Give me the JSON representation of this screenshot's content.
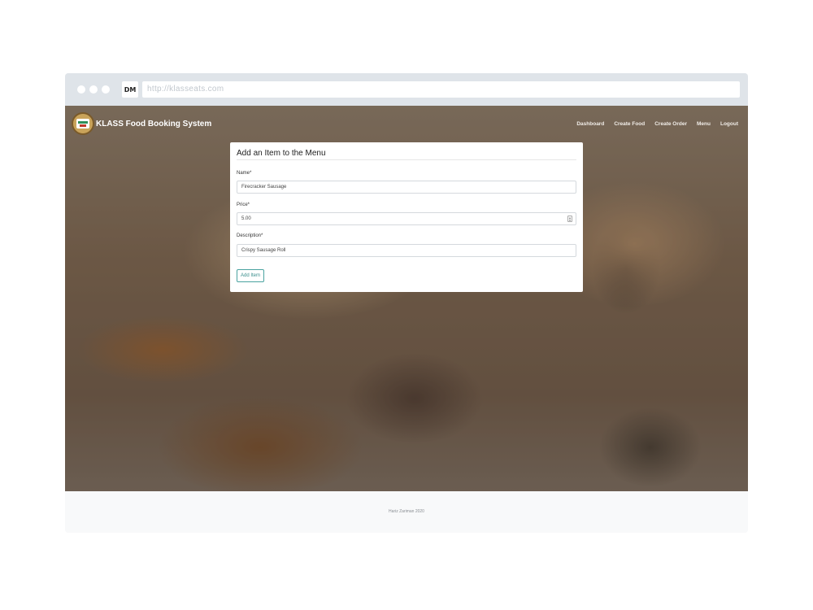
{
  "browser": {
    "logo_text": "DM",
    "url": "http://klasseats.com"
  },
  "navbar": {
    "brand": "KLASS Food Booking System",
    "links": [
      "Dashboard",
      "Create Food",
      "Create Order",
      "Menu",
      "Logout"
    ]
  },
  "form": {
    "title": "Add an Item to the Menu",
    "name_label": "Name*",
    "name_value": "Firecracker Sausage",
    "price_label": "Price*",
    "price_value": "5.00",
    "description_label": "Description*",
    "description_value": "Crispy Sausage Roll",
    "submit_label": "Add Item"
  },
  "footer": {
    "text": "Hariz Zariman 2020"
  }
}
